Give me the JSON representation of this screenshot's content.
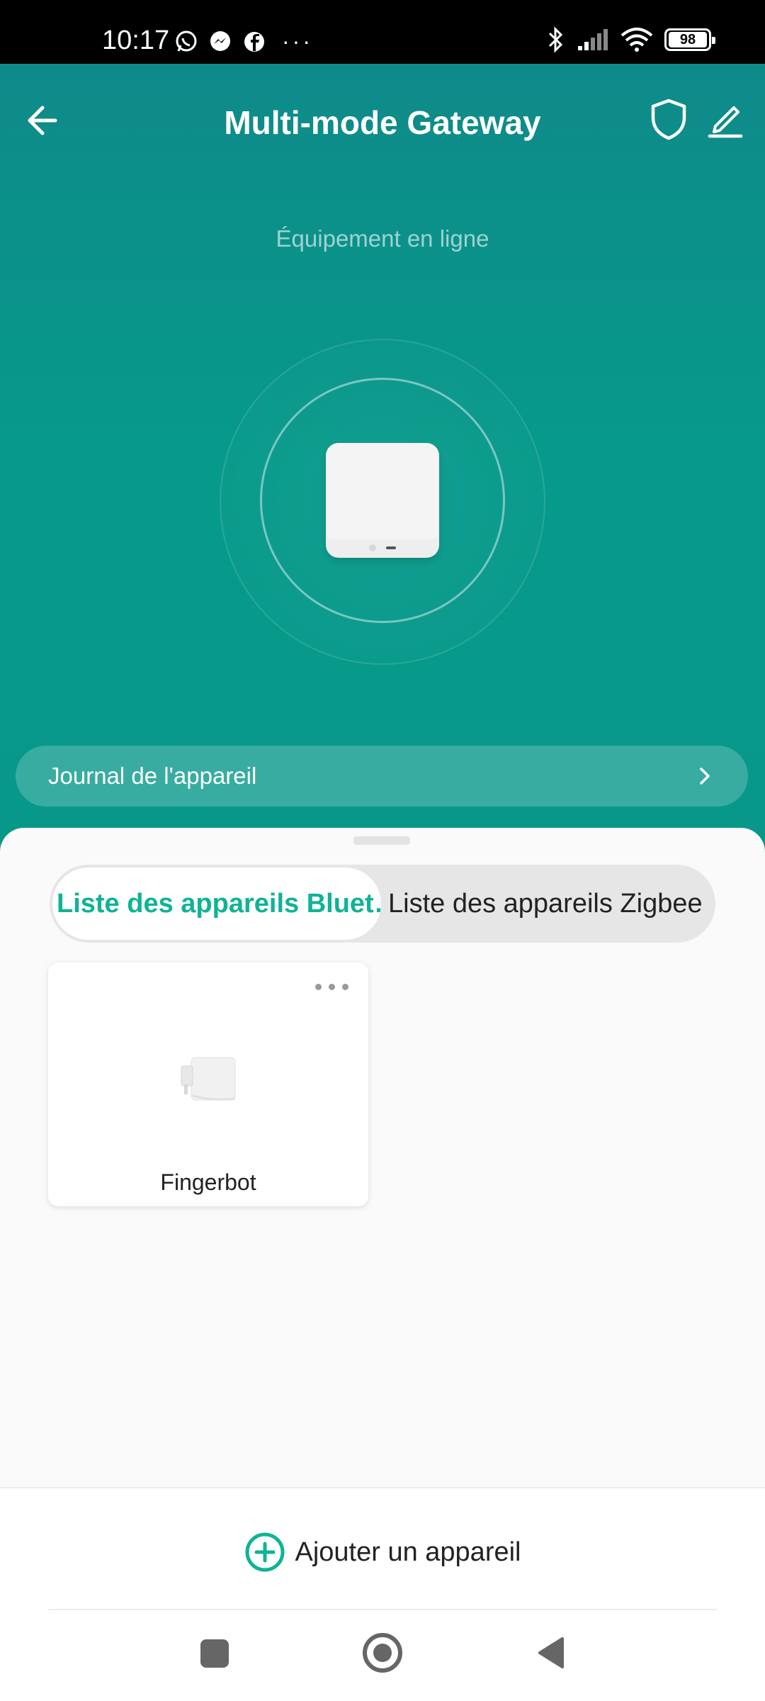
{
  "status_bar": {
    "time": "10:17",
    "battery": "98",
    "left_icons": [
      "whatsapp-icon",
      "messenger-icon",
      "facebook-icon",
      "more-dots-icon"
    ],
    "right_icons": [
      "bluetooth-icon",
      "signal-icon",
      "wifi-icon",
      "battery-icon"
    ]
  },
  "header": {
    "title": "Multi-mode Gateway",
    "status": "Équipement en ligne"
  },
  "log": {
    "label": "Journal de l'appareil"
  },
  "tabs": [
    {
      "label": "Liste des appareils Bluet…",
      "active": true
    },
    {
      "label": "Liste des appareils Zigbee",
      "active": false
    }
  ],
  "devices": [
    {
      "name": "Fingerbot"
    }
  ],
  "footer": {
    "add_label": "Ajouter un appareil"
  },
  "colors": {
    "accent": "#10b396",
    "header_bg": "#069a8a"
  }
}
